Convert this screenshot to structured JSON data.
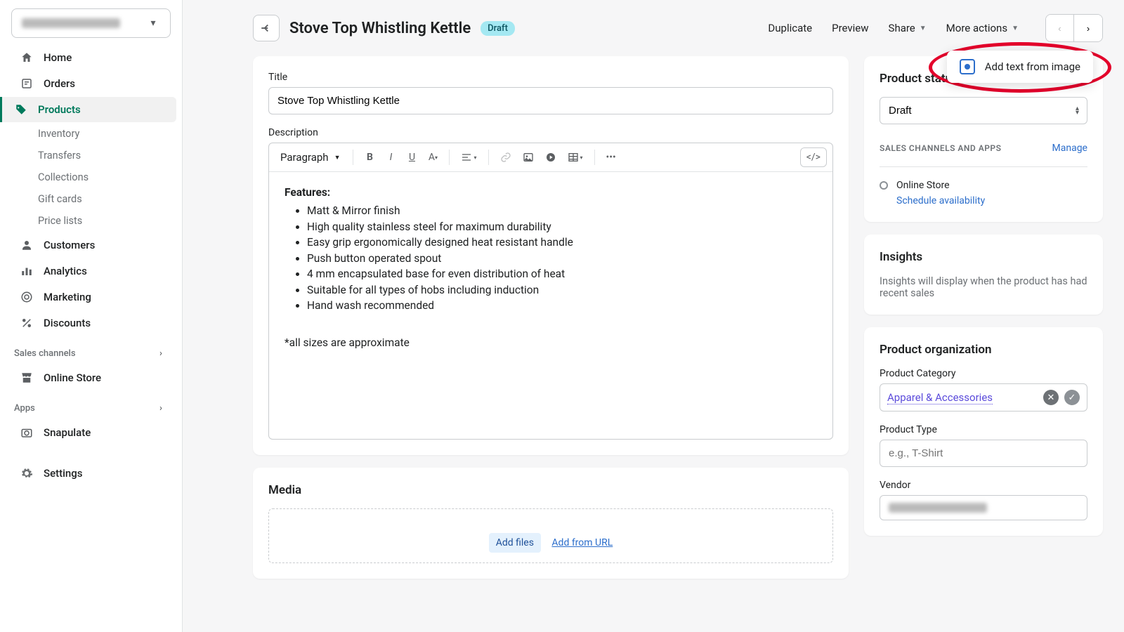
{
  "store_selector_placeholder": "",
  "nav": {
    "home": "Home",
    "orders": "Orders",
    "products": "Products",
    "products_sub": [
      "Inventory",
      "Transfers",
      "Collections",
      "Gift cards",
      "Price lists"
    ],
    "customers": "Customers",
    "analytics": "Analytics",
    "marketing": "Marketing",
    "discounts": "Discounts",
    "sales_channels_head": "Sales channels",
    "online_store": "Online Store",
    "apps_head": "Apps",
    "snapulate": "Snapulate",
    "settings": "Settings"
  },
  "header": {
    "title": "Stove Top Whistling Kettle",
    "badge": "Draft",
    "duplicate": "Duplicate",
    "preview": "Preview",
    "share": "Share",
    "more_actions": "More actions",
    "add_text_from_image": "Add text from image"
  },
  "title_card": {
    "label": "Title",
    "value": "Stove Top Whistling Kettle"
  },
  "description": {
    "label": "Description",
    "block_style": "Paragraph",
    "features_heading": "Features:",
    "features": [
      "Matt & Mirror finish",
      "High quality stainless steel for maximum durability",
      "Easy grip ergonomically designed heat resistant handle",
      "Push button operated spout",
      "4 mm encapsulated base for even distribution of heat",
      "Suitable for all types of hobs including induction",
      "Hand wash recommended"
    ],
    "footnote": "*all sizes are approximate"
  },
  "media": {
    "title": "Media",
    "add_files": "Add files",
    "add_from_url": "Add from URL"
  },
  "status": {
    "title": "Product status",
    "value": "Draft",
    "sales_channels_head": "SALES CHANNELS AND APPS",
    "manage": "Manage",
    "online_store": "Online Store",
    "schedule": "Schedule availability"
  },
  "insights": {
    "title": "Insights",
    "text": "Insights will display when the product has had recent sales"
  },
  "organization": {
    "title": "Product organization",
    "category_label": "Product Category",
    "category_value": "Apparel & Accessories",
    "type_label": "Product Type",
    "type_placeholder": "e.g., T-Shirt",
    "vendor_label": "Vendor"
  }
}
